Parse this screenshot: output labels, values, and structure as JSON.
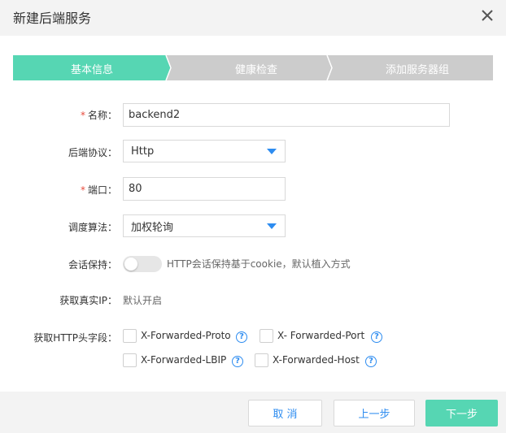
{
  "dialog": {
    "title": "新建后端服务"
  },
  "steps": [
    {
      "label": "基本信息",
      "state": "active"
    },
    {
      "label": "健康检查",
      "state": "inactive"
    },
    {
      "label": "添加服务器组",
      "state": "inactive"
    }
  ],
  "colors": {
    "step_active": "#56d6b3",
    "step_inactive": "#cccccc",
    "required": "#e84c3d",
    "link": "#2d8cf0",
    "primary_button": "#56d6b3"
  },
  "form": {
    "name": {
      "required_mark": "*",
      "label": "名称：",
      "value": "backend2"
    },
    "protocol": {
      "label": "后端协议：",
      "value": "Http"
    },
    "port": {
      "required_mark": "*",
      "label": "端口：",
      "value": "80"
    },
    "algorithm": {
      "label": "调度算法：",
      "value": "加权轮询"
    },
    "session": {
      "label": "会话保持：",
      "toggle_on": false,
      "hint": "HTTP会话保持基于cookie，默认植入方式"
    },
    "real_ip": {
      "label": "获取真实IP：",
      "value": "默认开启"
    },
    "http_headers": {
      "label": "获取HTTP头字段：",
      "options": [
        {
          "label": "X-Forwarded-Proto",
          "checked": false
        },
        {
          "label": "X- Forwarded-Port",
          "checked": false
        },
        {
          "label": "X-Forwarded-LBIP",
          "checked": false
        },
        {
          "label": "X-Forwarded-Host",
          "checked": false
        }
      ],
      "help_glyph": "?"
    }
  },
  "footer": {
    "cancel_label": "取 消",
    "prev_label": "上一步",
    "next_label": "下一步"
  }
}
